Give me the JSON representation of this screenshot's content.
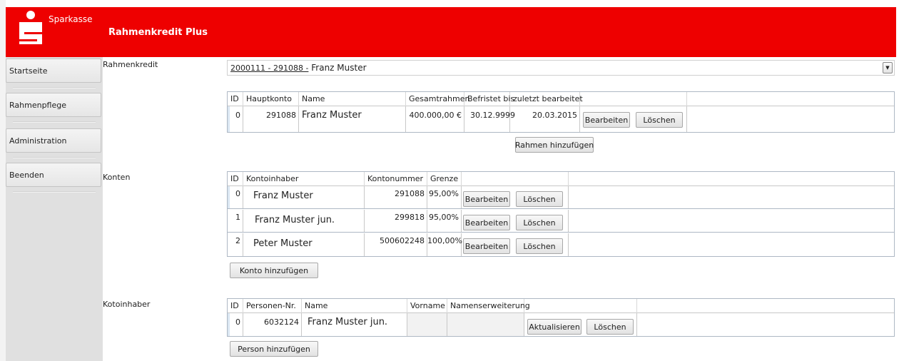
{
  "header": {
    "brand": "Sparkasse",
    "title": "Rahmenkredit Plus",
    "color": "#ee0000"
  },
  "sidebar": {
    "items": [
      {
        "label": "Startseite"
      },
      {
        "label": "Rahmenpflege"
      },
      {
        "label": "Administration"
      },
      {
        "label": "Beenden"
      }
    ]
  },
  "rahmenkredit": {
    "label": "Rahmenkredit",
    "selected_prefix": "2000111 - 291088 -",
    "selected_name": "Franz Muster",
    "columns": [
      "ID",
      "Hauptkonto",
      "Name",
      "Gesamtrahmen",
      "Befristet bis",
      "zuletzt bearbeitet"
    ],
    "rows": [
      {
        "id": "0",
        "hauptkonto": "291088",
        "name": "Franz Muster",
        "gesamtrahmen": "400.000,00 €",
        "befristet": "30.12.9999",
        "bearbeitet": "20.03.2015",
        "edit": "Bearbeiten",
        "delete": "Löschen"
      }
    ],
    "add_button": "Rahmen hinzufügen"
  },
  "konten": {
    "label": "Konten",
    "columns": [
      "ID",
      "Kontoinhaber",
      "Kontonummer",
      "Grenze"
    ],
    "rows": [
      {
        "id": "0",
        "inhaber": "Franz Muster",
        "kontonummer": "291088",
        "grenze": "95,00%",
        "edit": "Bearbeiten",
        "delete": "Löschen"
      },
      {
        "id": "1",
        "inhaber": "Franz Muster jun.",
        "kontonummer": "299818",
        "grenze": "95,00%",
        "edit": "Bearbeiten",
        "delete": "Löschen"
      },
      {
        "id": "2",
        "inhaber": "Peter Muster",
        "kontonummer": "500602248",
        "grenze": "100,00%",
        "edit": "Bearbeiten",
        "delete": "Löschen"
      }
    ],
    "add_button": "Konto hinzufügen"
  },
  "kontoinhaber": {
    "label": "Kotoinhaber",
    "columns": [
      "ID",
      "Personen-Nr.",
      "Name",
      "Vorname",
      "Namenserweiterung"
    ],
    "rows": [
      {
        "id": "0",
        "personen_nr": "6032124",
        "name": "Franz Muster jun.",
        "vorname": "",
        "erweiterung": "",
        "update": "Aktualisieren",
        "delete": "Löschen"
      }
    ],
    "add_button": "Person hinzufügen"
  }
}
